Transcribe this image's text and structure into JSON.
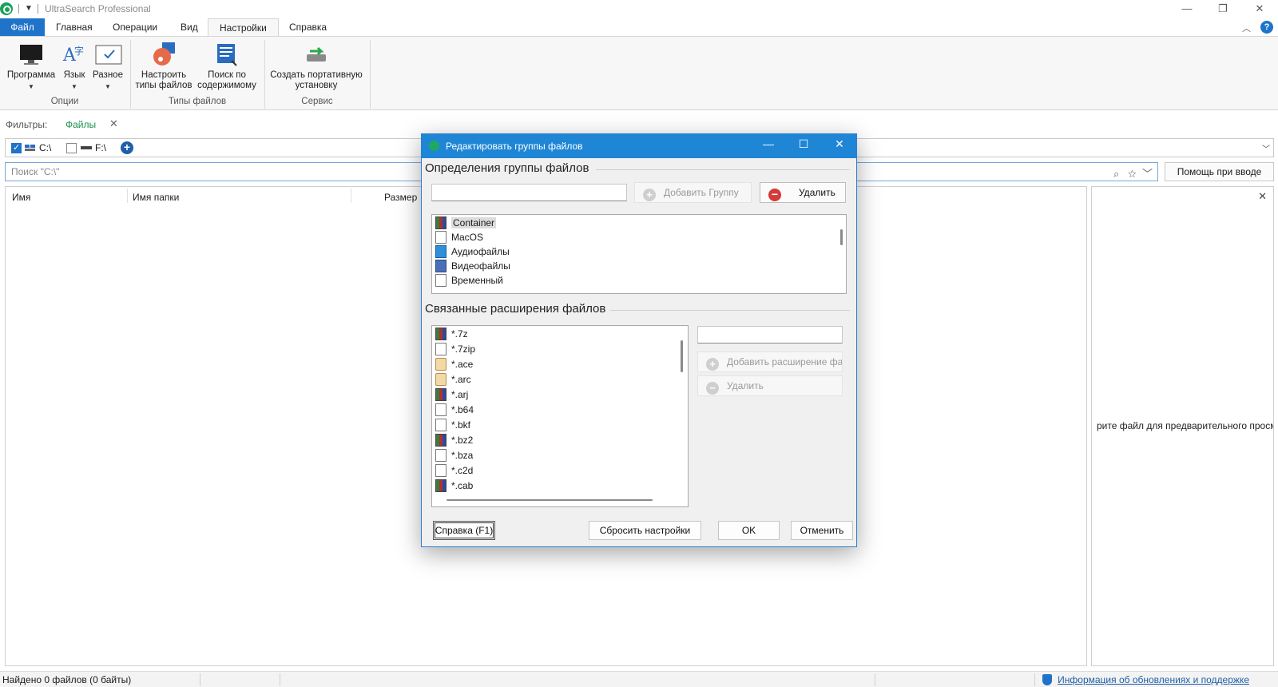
{
  "window": {
    "title": "UltraSearch Professional",
    "min": "—",
    "max": "❐",
    "close": "✕"
  },
  "ribbon_tabs": [
    "Файл",
    "Главная",
    "Операции",
    "Вид",
    "Настройки",
    "Справка"
  ],
  "ribbon": {
    "options": {
      "programma": "Программа",
      "yazyk": "Язык",
      "raznoe": "Разное",
      "group": "Опции"
    },
    "filetypes": {
      "configure_line1": "Настроить",
      "configure_line2": "типы файлов",
      "content_line1": "Поиск по",
      "content_line2": "содержимому",
      "group": "Типы файлов"
    },
    "service": {
      "portable_line1": "Создать портативную",
      "portable_line2": "установку",
      "group": "Сервис"
    }
  },
  "filters": {
    "label": "Фильтры:",
    "tag": "Файлы"
  },
  "drives": [
    {
      "label": "C:\\",
      "checked": true
    },
    {
      "label": "F:\\",
      "checked": false
    }
  ],
  "search": {
    "placeholder": "Поиск \"C:\\\"",
    "help_button": "Помощь при вводе"
  },
  "results": {
    "columns": [
      "Имя",
      "Имя папки",
      "Размер"
    ]
  },
  "preview": {
    "text": "рите файл для предварительного просм"
  },
  "status": {
    "found": "Найдено 0 файлов (0 байты)",
    "link": "Информация об обновлениях и поддержке"
  },
  "dialog": {
    "title": "Редактировать группы файлов",
    "group_section": "Определения группы файлов",
    "add_group": "Добавить Группу",
    "delete": "Удалить",
    "groups": [
      {
        "name": "Container",
        "icon": "archive-icon"
      },
      {
        "name": "MacOS",
        "icon": "file-icon"
      },
      {
        "name": "Аудиофайлы",
        "icon": "audio-icon"
      },
      {
        "name": "Видеофайлы",
        "icon": "video-icon"
      },
      {
        "name": "Временный",
        "icon": "file-icon"
      }
    ],
    "ext_section": "Связанные расширения файлов",
    "add_ext": "Добавить расширение фай",
    "delete_ext": "Удалить",
    "extensions": [
      {
        "name": "*.7z",
        "icon": "archive-icon"
      },
      {
        "name": "*.7zip",
        "icon": "file-icon"
      },
      {
        "name": "*.ace",
        "icon": "ace-icon"
      },
      {
        "name": "*.arc",
        "icon": "ace-icon"
      },
      {
        "name": "*.arj",
        "icon": "archive-icon"
      },
      {
        "name": "*.b64",
        "icon": "file-icon"
      },
      {
        "name": "*.bkf",
        "icon": "file-icon"
      },
      {
        "name": "*.bz2",
        "icon": "archive-icon"
      },
      {
        "name": "*.bza",
        "icon": "file-icon"
      },
      {
        "name": "*.c2d",
        "icon": "file-icon"
      },
      {
        "name": "*.cab",
        "icon": "archive-icon"
      }
    ],
    "help": "Справка (F1)",
    "reset": "Сбросить настройки",
    "ok": "OK",
    "cancel": "Отменить"
  }
}
